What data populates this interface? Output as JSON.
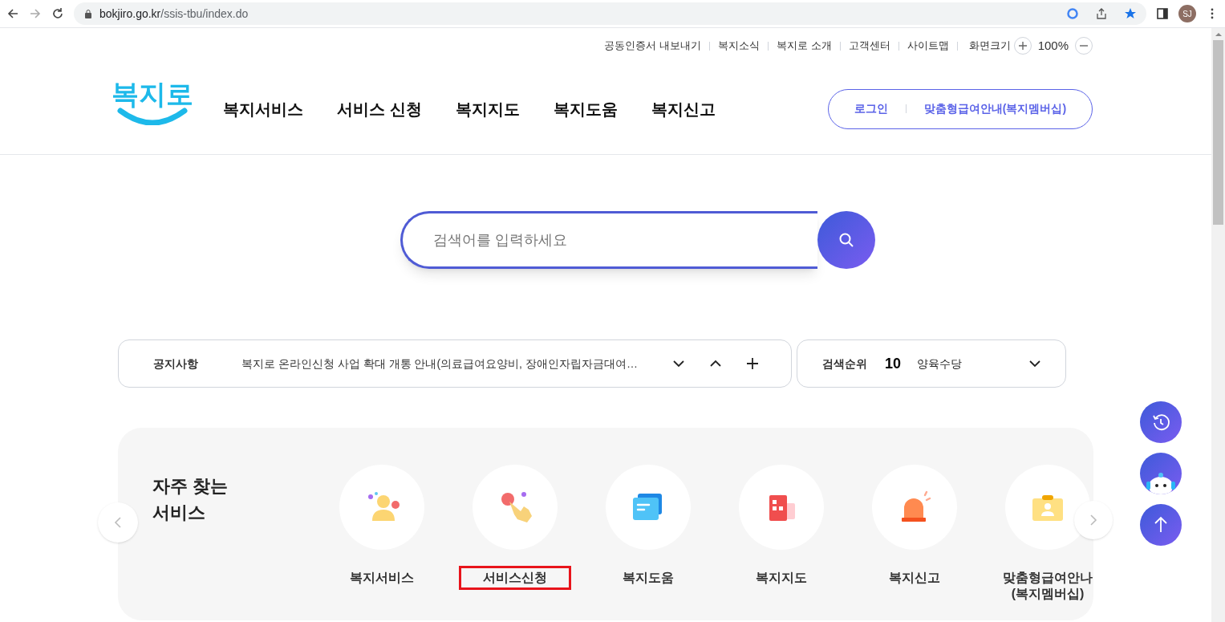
{
  "browser": {
    "url_host": "bokjiro.go.kr",
    "url_path": "/ssis-tbu/index.do",
    "profile": "SJ"
  },
  "utility_links": [
    "공동인증서 내보내기",
    "복지소식",
    "복지로 소개",
    "고객센터",
    "사이트맵"
  ],
  "zoom": {
    "label": "화면크기",
    "value": "100%"
  },
  "logo": "복지로",
  "main_nav": [
    "복지서비스",
    "서비스 신청",
    "복지지도",
    "복지도움",
    "복지신고"
  ],
  "account": [
    "로그인",
    "맞춤형급여안내(복지멤버십)"
  ],
  "search": {
    "placeholder": "검색어를 입력하세요"
  },
  "notice": {
    "label": "공지사항",
    "text": "복지로 온라인신청 사업 확대 개통 안내(의료급여요양비, 장애인자립자금대여…"
  },
  "ranking": {
    "label": "검색순위",
    "rank": "10",
    "term": "양육수당"
  },
  "frequent": {
    "title": "자주 찾는 서비스",
    "items": [
      {
        "label": "복지서비스",
        "highlighted": false
      },
      {
        "label": "서비스신청",
        "highlighted": true
      },
      {
        "label": "복지도움",
        "highlighted": false
      },
      {
        "label": "복지지도",
        "highlighted": false
      },
      {
        "label": "복지신고",
        "highlighted": false
      },
      {
        "label": "맞춤형급여안나 (복지멤버십)",
        "highlighted": false
      }
    ]
  }
}
